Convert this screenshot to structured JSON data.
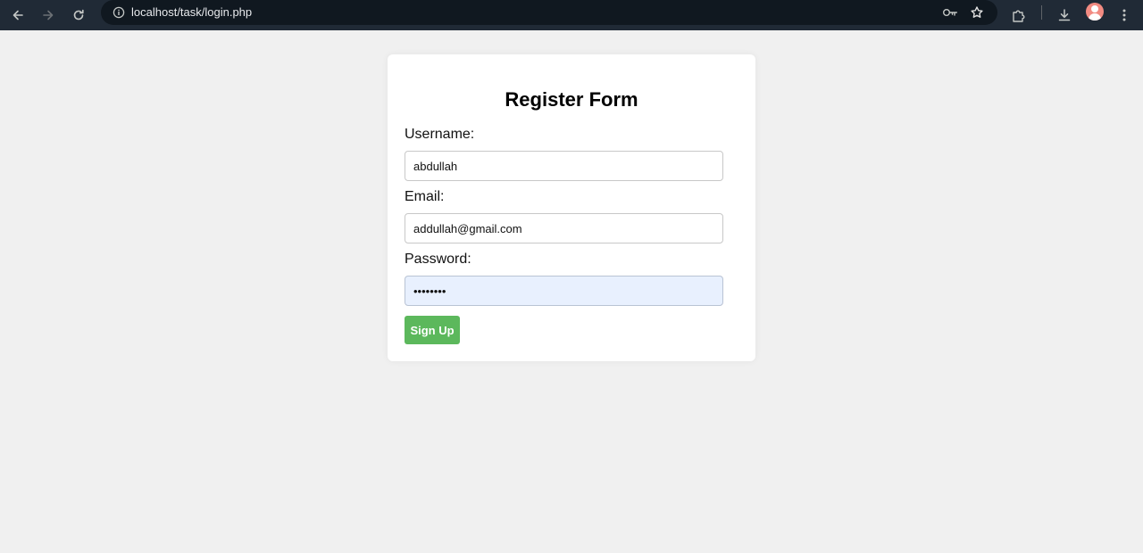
{
  "browser": {
    "url_host": "localhost",
    "url_path": "/task/login.php",
    "icons": {
      "back": "back-arrow-icon",
      "forward": "forward-arrow-icon",
      "reload": "reload-icon",
      "site_info": "info-icon",
      "password": "key-icon",
      "bookmark": "star-icon",
      "extensions": "puzzle-icon",
      "downloads": "download-icon",
      "profile": "avatar",
      "menu": "kebab-menu-icon"
    }
  },
  "form": {
    "title": "Register Form",
    "username_label": "Username:",
    "username_value": "abdullah",
    "email_label": "Email:",
    "email_value": "addullah@gmail.com",
    "password_label": "Password:",
    "password_value": "••••••••",
    "submit_label": "Sign Up"
  },
  "colors": {
    "page_bg": "#f0f0f0",
    "toolbar_bg": "#202a36",
    "button_bg": "#5cb85c",
    "autofill_bg": "#e8f0fe"
  }
}
